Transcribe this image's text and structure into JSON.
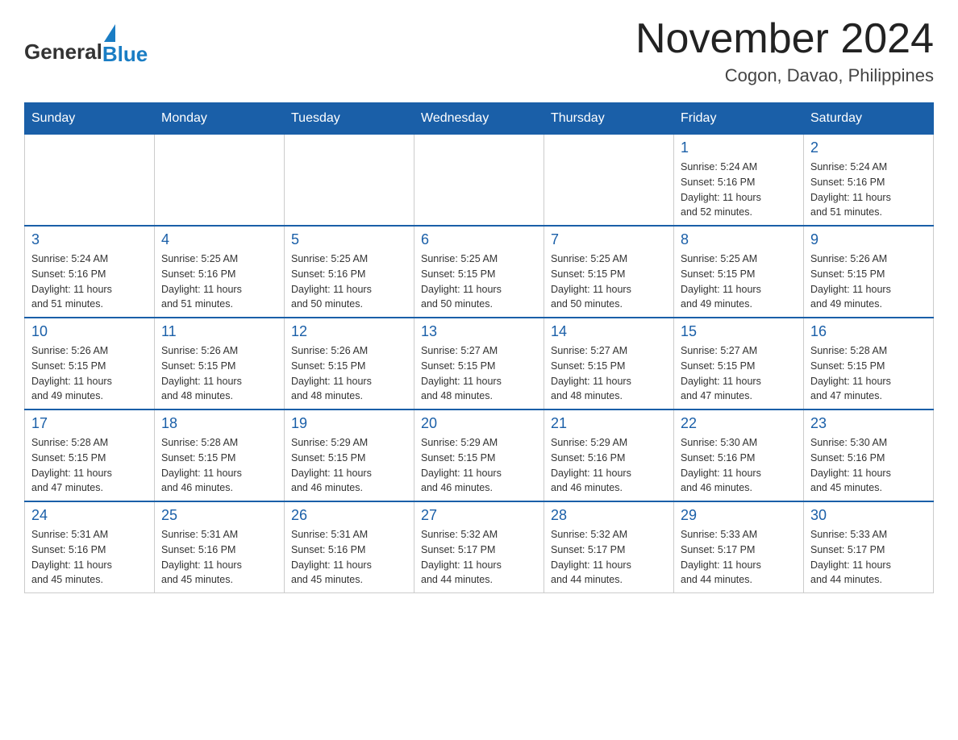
{
  "header": {
    "logo_general": "General",
    "logo_blue": "Blue",
    "month_title": "November 2024",
    "location": "Cogon, Davao, Philippines"
  },
  "days_of_week": [
    "Sunday",
    "Monday",
    "Tuesday",
    "Wednesday",
    "Thursday",
    "Friday",
    "Saturday"
  ],
  "weeks": [
    [
      {
        "day": "",
        "info": ""
      },
      {
        "day": "",
        "info": ""
      },
      {
        "day": "",
        "info": ""
      },
      {
        "day": "",
        "info": ""
      },
      {
        "day": "",
        "info": ""
      },
      {
        "day": "1",
        "info": "Sunrise: 5:24 AM\nSunset: 5:16 PM\nDaylight: 11 hours\nand 52 minutes."
      },
      {
        "day": "2",
        "info": "Sunrise: 5:24 AM\nSunset: 5:16 PM\nDaylight: 11 hours\nand 51 minutes."
      }
    ],
    [
      {
        "day": "3",
        "info": "Sunrise: 5:24 AM\nSunset: 5:16 PM\nDaylight: 11 hours\nand 51 minutes."
      },
      {
        "day": "4",
        "info": "Sunrise: 5:25 AM\nSunset: 5:16 PM\nDaylight: 11 hours\nand 51 minutes."
      },
      {
        "day": "5",
        "info": "Sunrise: 5:25 AM\nSunset: 5:16 PM\nDaylight: 11 hours\nand 50 minutes."
      },
      {
        "day": "6",
        "info": "Sunrise: 5:25 AM\nSunset: 5:15 PM\nDaylight: 11 hours\nand 50 minutes."
      },
      {
        "day": "7",
        "info": "Sunrise: 5:25 AM\nSunset: 5:15 PM\nDaylight: 11 hours\nand 50 minutes."
      },
      {
        "day": "8",
        "info": "Sunrise: 5:25 AM\nSunset: 5:15 PM\nDaylight: 11 hours\nand 49 minutes."
      },
      {
        "day": "9",
        "info": "Sunrise: 5:26 AM\nSunset: 5:15 PM\nDaylight: 11 hours\nand 49 minutes."
      }
    ],
    [
      {
        "day": "10",
        "info": "Sunrise: 5:26 AM\nSunset: 5:15 PM\nDaylight: 11 hours\nand 49 minutes."
      },
      {
        "day": "11",
        "info": "Sunrise: 5:26 AM\nSunset: 5:15 PM\nDaylight: 11 hours\nand 48 minutes."
      },
      {
        "day": "12",
        "info": "Sunrise: 5:26 AM\nSunset: 5:15 PM\nDaylight: 11 hours\nand 48 minutes."
      },
      {
        "day": "13",
        "info": "Sunrise: 5:27 AM\nSunset: 5:15 PM\nDaylight: 11 hours\nand 48 minutes."
      },
      {
        "day": "14",
        "info": "Sunrise: 5:27 AM\nSunset: 5:15 PM\nDaylight: 11 hours\nand 48 minutes."
      },
      {
        "day": "15",
        "info": "Sunrise: 5:27 AM\nSunset: 5:15 PM\nDaylight: 11 hours\nand 47 minutes."
      },
      {
        "day": "16",
        "info": "Sunrise: 5:28 AM\nSunset: 5:15 PM\nDaylight: 11 hours\nand 47 minutes."
      }
    ],
    [
      {
        "day": "17",
        "info": "Sunrise: 5:28 AM\nSunset: 5:15 PM\nDaylight: 11 hours\nand 47 minutes."
      },
      {
        "day": "18",
        "info": "Sunrise: 5:28 AM\nSunset: 5:15 PM\nDaylight: 11 hours\nand 46 minutes."
      },
      {
        "day": "19",
        "info": "Sunrise: 5:29 AM\nSunset: 5:15 PM\nDaylight: 11 hours\nand 46 minutes."
      },
      {
        "day": "20",
        "info": "Sunrise: 5:29 AM\nSunset: 5:15 PM\nDaylight: 11 hours\nand 46 minutes."
      },
      {
        "day": "21",
        "info": "Sunrise: 5:29 AM\nSunset: 5:16 PM\nDaylight: 11 hours\nand 46 minutes."
      },
      {
        "day": "22",
        "info": "Sunrise: 5:30 AM\nSunset: 5:16 PM\nDaylight: 11 hours\nand 46 minutes."
      },
      {
        "day": "23",
        "info": "Sunrise: 5:30 AM\nSunset: 5:16 PM\nDaylight: 11 hours\nand 45 minutes."
      }
    ],
    [
      {
        "day": "24",
        "info": "Sunrise: 5:31 AM\nSunset: 5:16 PM\nDaylight: 11 hours\nand 45 minutes."
      },
      {
        "day": "25",
        "info": "Sunrise: 5:31 AM\nSunset: 5:16 PM\nDaylight: 11 hours\nand 45 minutes."
      },
      {
        "day": "26",
        "info": "Sunrise: 5:31 AM\nSunset: 5:16 PM\nDaylight: 11 hours\nand 45 minutes."
      },
      {
        "day": "27",
        "info": "Sunrise: 5:32 AM\nSunset: 5:17 PM\nDaylight: 11 hours\nand 44 minutes."
      },
      {
        "day": "28",
        "info": "Sunrise: 5:32 AM\nSunset: 5:17 PM\nDaylight: 11 hours\nand 44 minutes."
      },
      {
        "day": "29",
        "info": "Sunrise: 5:33 AM\nSunset: 5:17 PM\nDaylight: 11 hours\nand 44 minutes."
      },
      {
        "day": "30",
        "info": "Sunrise: 5:33 AM\nSunset: 5:17 PM\nDaylight: 11 hours\nand 44 minutes."
      }
    ]
  ]
}
